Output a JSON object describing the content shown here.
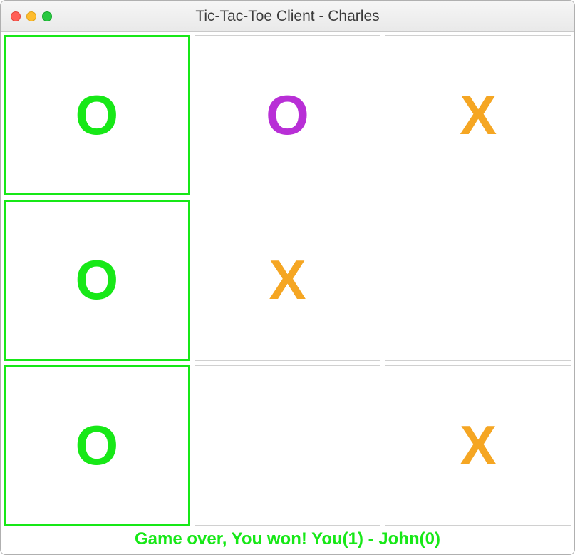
{
  "window": {
    "title": "Tic-Tac-Toe Client - Charles"
  },
  "board": {
    "cells": [
      {
        "mark": "O",
        "color": "green",
        "win": true
      },
      {
        "mark": "O",
        "color": "purple",
        "win": false
      },
      {
        "mark": "X",
        "color": "orange",
        "win": false
      },
      {
        "mark": "O",
        "color": "green",
        "win": true
      },
      {
        "mark": "X",
        "color": "orange",
        "win": false
      },
      {
        "mark": "",
        "color": "",
        "win": false
      },
      {
        "mark": "O",
        "color": "green",
        "win": true
      },
      {
        "mark": "",
        "color": "",
        "win": false
      },
      {
        "mark": "X",
        "color": "orange",
        "win": false
      }
    ]
  },
  "status": {
    "text": "Game over, You won! You(1) - John(0)"
  },
  "colors": {
    "win_border": "#17e817",
    "o_green": "#17e817",
    "o_purple": "#b82fd6",
    "x_orange": "#f5a623"
  }
}
